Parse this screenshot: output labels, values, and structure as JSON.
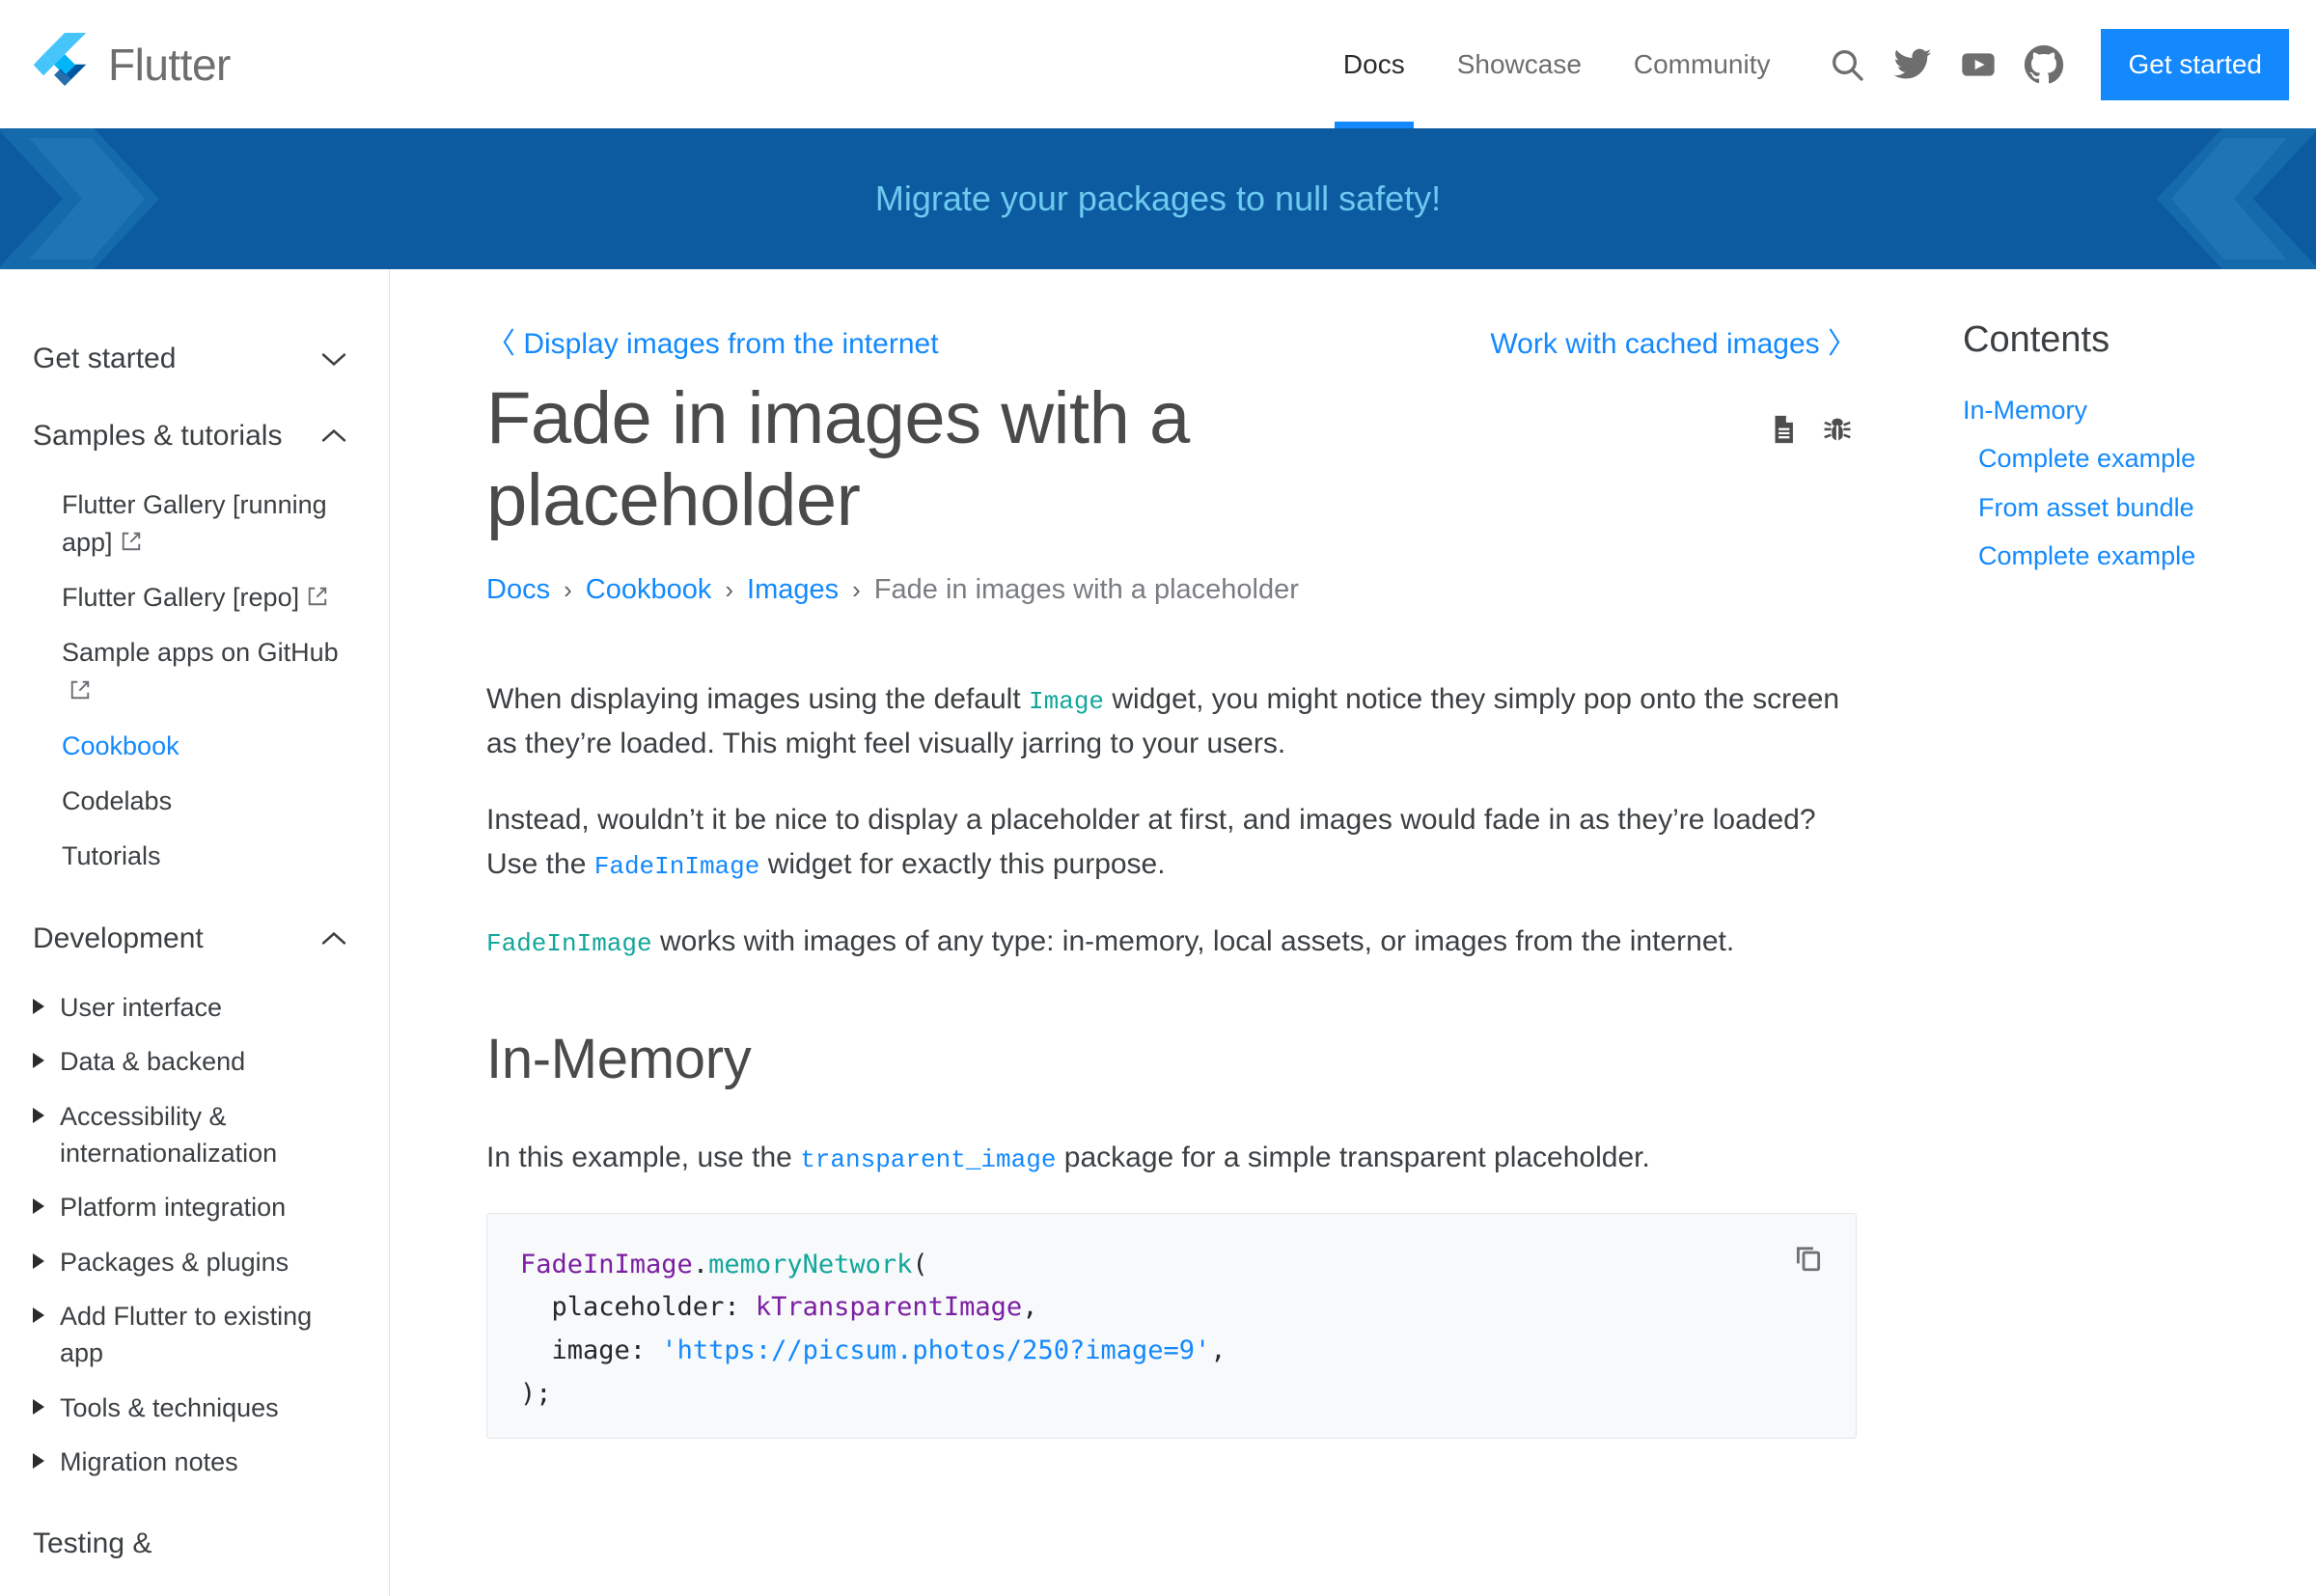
{
  "header": {
    "brand": "Flutter",
    "brand_logo_icon": "flutter-logo-icon",
    "nav": [
      {
        "label": "Docs",
        "active": true
      },
      {
        "label": "Showcase",
        "active": false
      },
      {
        "label": "Community",
        "active": false
      }
    ],
    "icons": [
      {
        "name": "search-icon"
      },
      {
        "name": "twitter-icon"
      },
      {
        "name": "youtube-icon"
      },
      {
        "name": "github-icon"
      }
    ],
    "cta_label": "Get started",
    "accent_color": "#1389fd"
  },
  "banner": {
    "text": "Migrate your packages to null safety!",
    "background_color": "#0c5ba0",
    "text_color": "#6cc9f0"
  },
  "sidebar": {
    "sections": [
      {
        "label": "Get started",
        "state_icon": "chevron-down-icon"
      },
      {
        "label": "Samples & tutorials",
        "state_icon": "chevron-up-icon"
      }
    ],
    "samples_items": [
      {
        "label": "Flutter Gallery [running app]",
        "external": true,
        "active": false
      },
      {
        "label": "Flutter Gallery [repo]",
        "external": true,
        "active": false
      },
      {
        "label": "Sample apps on GitHub",
        "external": true,
        "active": false
      },
      {
        "label": "Cookbook",
        "external": false,
        "active": true
      },
      {
        "label": "Codelabs",
        "external": false,
        "active": false
      },
      {
        "label": "Tutorials",
        "external": false,
        "active": false
      }
    ],
    "development": {
      "label": "Development",
      "state_icon": "chevron-up-icon"
    },
    "development_items": [
      {
        "label": "User interface"
      },
      {
        "label": "Data & backend"
      },
      {
        "label": "Accessibility & internationalization"
      },
      {
        "label": "Platform integration"
      },
      {
        "label": "Packages & plugins"
      },
      {
        "label": "Add Flutter to existing app"
      },
      {
        "label": "Tools & techniques"
      },
      {
        "label": "Migration notes"
      }
    ],
    "next_section": {
      "label": "Testing &"
    }
  },
  "pager": {
    "prev_label": "Display images from the internet",
    "prev_chevron": "〈",
    "next_label": "Work with cached images",
    "next_chevron": "〉"
  },
  "page": {
    "title": "Fade in images with a placeholder",
    "actions": [
      {
        "name": "page-source-icon"
      },
      {
        "name": "bug-report-icon"
      }
    ]
  },
  "breadcrumb": {
    "items": [
      {
        "label": "Docs",
        "current": false
      },
      {
        "label": "Cookbook",
        "current": false
      },
      {
        "label": "Images",
        "current": false
      },
      {
        "label": "Fade in images with a placeholder",
        "current": true
      }
    ],
    "separator": "›"
  },
  "content": {
    "p1_a": "When displaying images using the default ",
    "p1_code": "Image",
    "p1_b": " widget, you might notice they simply pop onto the screen as they’re loaded. This might feel visually jarring to your users.",
    "p2_a": "Instead, wouldn’t it be nice to display a placeholder at first, and images would fade in as they’re loaded? Use the ",
    "p2_code": "FadeInImage",
    "p2_b": " widget for exactly this purpose.",
    "p3_code": "FadeInImage",
    "p3_b": " works with images of any type: in-memory, local assets, or images from the internet.",
    "section_heading": "In-Memory",
    "p4_a": "In this example, use the ",
    "p4_code": "transparent_image",
    "p4_b": " package for a simple transparent placeholder."
  },
  "code_sample": {
    "copy_icon": "copy-icon",
    "lines": [
      {
        "parts": [
          {
            "t": "FadeInImage",
            "k": "cls"
          },
          {
            "t": ".",
            "k": "pln"
          },
          {
            "t": "memoryNetwork",
            "k": "fn"
          },
          {
            "t": "(",
            "k": "pln"
          }
        ]
      },
      {
        "parts": [
          {
            "t": "  placeholder: ",
            "k": "pln"
          },
          {
            "t": "kTransparentImage",
            "k": "cls"
          },
          {
            "t": ",",
            "k": "pln"
          }
        ]
      },
      {
        "parts": [
          {
            "t": "  image: ",
            "k": "pln"
          },
          {
            "t": "'https://picsum.photos/250?image=9'",
            "k": "str"
          },
          {
            "t": ",",
            "k": "pln"
          }
        ]
      },
      {
        "parts": [
          {
            "t": ");",
            "k": "pln"
          }
        ]
      }
    ]
  },
  "toc": {
    "title": "Contents",
    "items": [
      {
        "label": "In-Memory",
        "level": 1
      },
      {
        "label": "Complete example",
        "level": 2
      },
      {
        "label": "From asset bundle",
        "level": 2
      },
      {
        "label": "Complete example",
        "level": 2
      }
    ]
  }
}
